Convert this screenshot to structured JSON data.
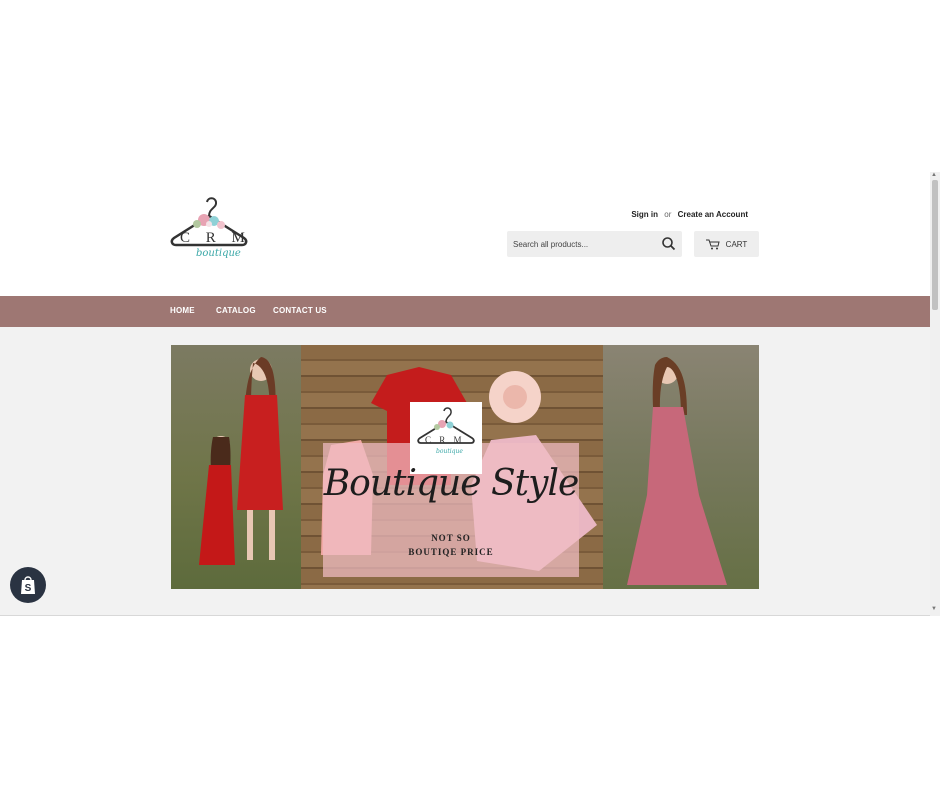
{
  "header": {
    "logo_text": "C R M",
    "logo_script": "boutique",
    "sign_in": "Sign in",
    "or": "or",
    "create_account": "Create an Account",
    "search_placeholder": "Search all products...",
    "search_icon": "search-icon",
    "cart_icon": "cart-icon",
    "cart_label": "CART"
  },
  "nav": {
    "items": [
      {
        "label": "HOME"
      },
      {
        "label": "CATALOG"
      },
      {
        "label": "CONTACT US"
      }
    ],
    "color": "#9e7773"
  },
  "hero": {
    "logo_text": "C R M",
    "logo_script": "boutique",
    "title": "Boutique Style",
    "subtitle_line1": "NOT SO",
    "subtitle_line2": "BOUTIQE PRICE",
    "overlay_color": "#f0bcc4"
  },
  "badge": {
    "icon": "shopify-bag-icon"
  }
}
